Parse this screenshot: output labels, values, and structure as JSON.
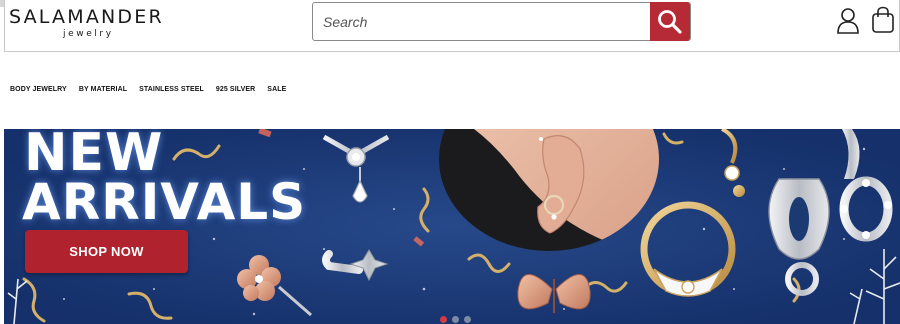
{
  "header": {
    "logo_main": "SALAMANDER",
    "logo_sub": "jewelry",
    "search_placeholder": "Search"
  },
  "nav": {
    "items": [
      "BODY JEWELRY",
      "BY MATERIAL",
      "STAINLESS STEEL",
      "925 SILVER",
      "SALE"
    ]
  },
  "hero": {
    "title_line1": "NEW",
    "title_line2": "ARRIVALS",
    "cta_label": "SHOP NOW",
    "slide_count": 3,
    "active_slide": 1
  },
  "colors": {
    "brand_red": "#b52a34",
    "hero_blue": "#1a3974",
    "gold": "#d4b06a"
  },
  "icons": [
    "search-icon",
    "user-icon",
    "shopping-bag-icon",
    "salamander-logo-icon"
  ]
}
